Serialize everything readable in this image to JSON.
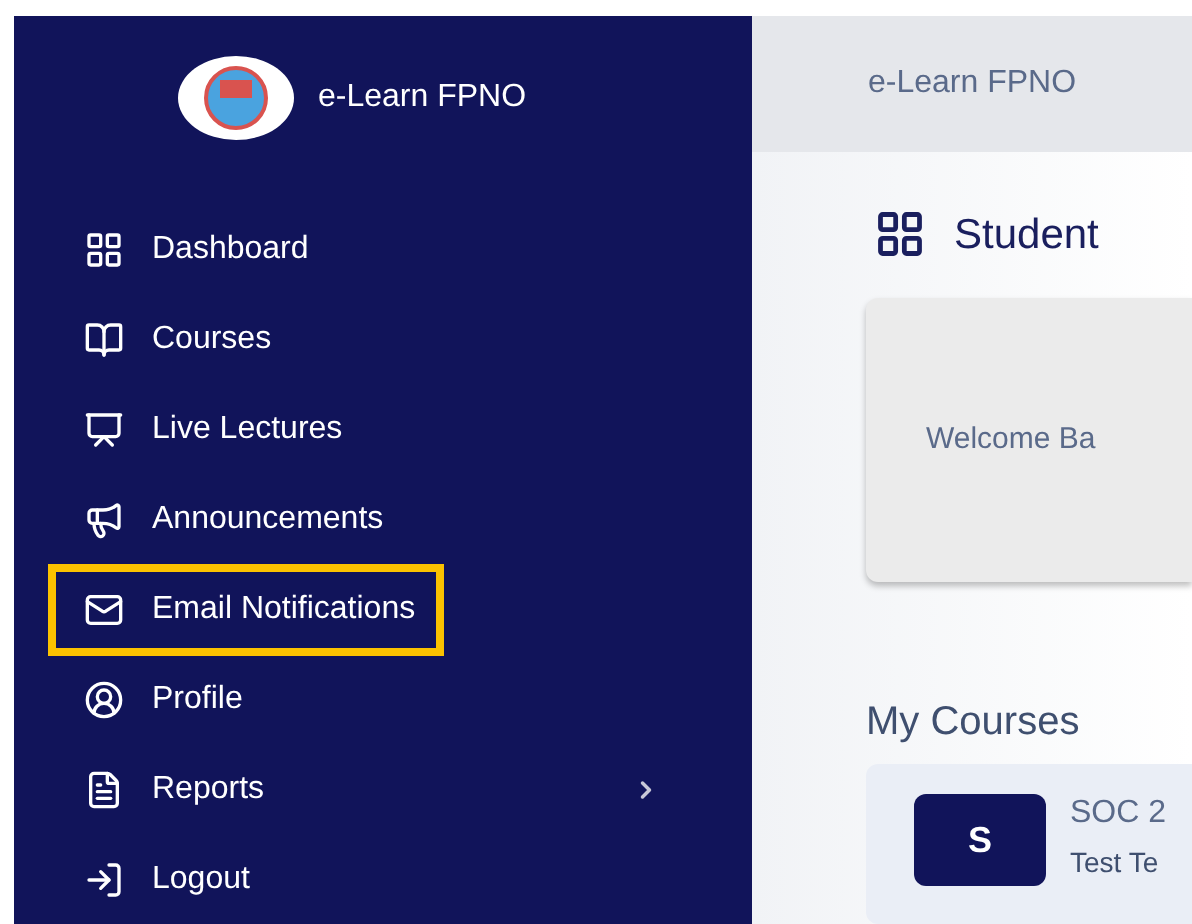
{
  "sidebar": {
    "brand": "e-Learn FPNO",
    "items": [
      {
        "label": "Dashboard",
        "highlighted": false,
        "has_submenu": false
      },
      {
        "label": "Courses",
        "highlighted": false,
        "has_submenu": false
      },
      {
        "label": "Live Lectures",
        "highlighted": false,
        "has_submenu": false
      },
      {
        "label": "Announcements",
        "highlighted": false,
        "has_submenu": false
      },
      {
        "label": "Email Notifications",
        "highlighted": true,
        "has_submenu": false
      },
      {
        "label": "Profile",
        "highlighted": false,
        "has_submenu": false
      },
      {
        "label": "Reports",
        "highlighted": false,
        "has_submenu": true
      },
      {
        "label": "Logout",
        "highlighted": false,
        "has_submenu": false
      }
    ]
  },
  "header": {
    "title": "e-Learn FPNO"
  },
  "main": {
    "page_title": "Student",
    "welcome": "Welcome Ba",
    "section_title": "My Courses",
    "courses": [
      {
        "initial": "S",
        "code": "SOC 2",
        "teacher": "Test Te"
      }
    ]
  }
}
